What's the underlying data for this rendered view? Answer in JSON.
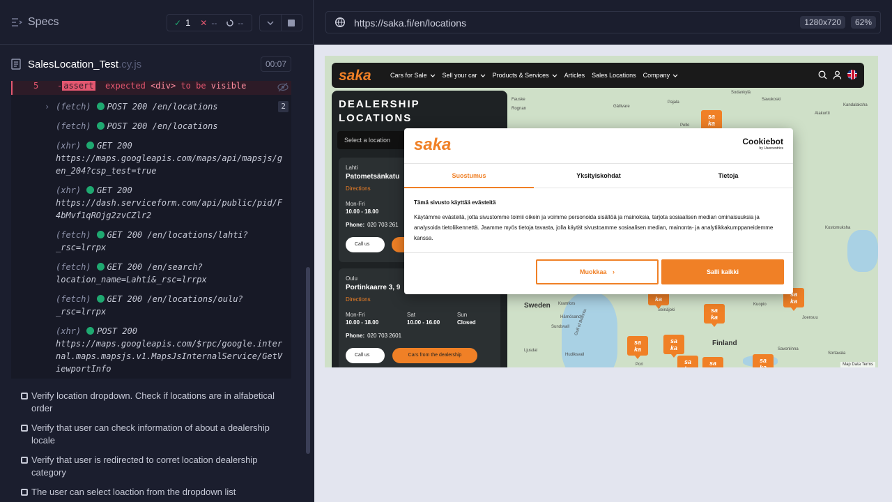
{
  "runner": {
    "specs_label": "Specs",
    "stats": {
      "passed": "1",
      "failed": "--",
      "pending": "--"
    },
    "file": {
      "name": "SalesLocation_Test",
      "ext": ".cy.js",
      "timer": "00:07"
    },
    "failed_command": {
      "number": "5",
      "prefix": "-",
      "assert": "assert",
      "text1": "expected",
      "tag": "<div>",
      "text2": "to be",
      "text3": "visible"
    },
    "commands": [
      {
        "kind": "(fetch)",
        "msg": "POST 200 /en/locations",
        "count": "2",
        "expandable": true
      },
      {
        "kind": "(fetch)",
        "msg": "POST 200 /en/locations"
      },
      {
        "kind": "(xhr)",
        "msg": "GET 200",
        "url": "https://maps.googleapis.com/maps/api/mapsjs/gen_204?csp_test=true"
      },
      {
        "kind": "(xhr)",
        "msg": "GET 200",
        "url": "https://dash.serviceform.com/api/public/pid/F4bMvf1qROjg2zvCZlr2"
      },
      {
        "kind": "(fetch)",
        "msg": "GET 200 /en/locations/lahti?",
        "url": "_rsc=lrrpx"
      },
      {
        "kind": "(fetch)",
        "msg": "GET 200 /en/search?",
        "url": "location_name=Lahti&_rsc=lrrpx"
      },
      {
        "kind": "(fetch)",
        "msg": "GET 200 /en/locations/oulu?",
        "url": "_rsc=lrrpx"
      },
      {
        "kind": "(xhr)",
        "msg": "POST 200",
        "url": "https://maps.googleapis.com/$rpc/google.internal.maps.mapsjs.v1.MapsJsInternalService/GetViewportInfo"
      }
    ],
    "tests": [
      "Verify location dropdown. Check if locations are in alfabetical order",
      "Verify that user can check information of about a dealership locale",
      "Verify that user is redirected to corret location dealership category",
      "The user can select loaction from the dropdown list"
    ]
  },
  "browser": {
    "url": "https://saka.fi/en/locations",
    "viewport": "1280x720",
    "zoom": "62%"
  },
  "site": {
    "brand": "saka",
    "nav": [
      "Cars for Sale",
      "Sell your car",
      "Products & Services",
      "Articles",
      "Sales Locations",
      "Company"
    ],
    "nav_dropdowns": [
      true,
      true,
      true,
      false,
      false,
      true
    ],
    "panel_title": "DEALERSHIP LOCATIONS",
    "select_placeholder": "Select a location",
    "cards": [
      {
        "city": "Lahti",
        "address": "Patometsänkatu",
        "directions": "Directions",
        "hours_label": "Mon-Fri",
        "hours_value": "10.00 - 18.00",
        "phone_label": "Phone:",
        "phone": "020 703 261",
        "call": "Call us"
      },
      {
        "city": "Oulu",
        "address": "Portinkaarre 3, 9",
        "directions": "Directions",
        "hours_label": "Mon-Fri",
        "hours_value": "10.00 - 18.00",
        "sat_label": "Sat",
        "sat_value": "10.00 - 16.00",
        "sun_label": "Sun",
        "sun_value": "Closed",
        "phone_label": "Phone:",
        "phone": "020 703 2601",
        "call": "Call us",
        "cars": "Cars from the dealership"
      }
    ],
    "map": {
      "countries": [
        "Sweden",
        "Finland"
      ],
      "cities": [
        "Fauske",
        "Rognan",
        "Pajala",
        "Gällivare",
        "Sodankylä",
        "Savukoski",
        "Pello",
        "Kandalaksha",
        "Alakurtti",
        "Kramfors",
        "Seinäjoki",
        "Härnösand",
        "Kuopio",
        "Joensuu",
        "Sundsvall",
        "Ljusdal",
        "Hudiksvall",
        "Savonlinna",
        "Pori",
        "Kostomuksha",
        "Gulf of Bothnia",
        "Sortavala"
      ],
      "attribution": [
        "Map Data",
        "Terms"
      ]
    },
    "cookie": {
      "brand": "saka",
      "provider": "Cookiebot",
      "provider_sub": "by Usercentrics",
      "tabs": [
        "Suostumus",
        "Yksityiskohdat",
        "Tietoja"
      ],
      "active_tab": 0,
      "heading": "Tämä sivusto käyttää evästeitä",
      "body": "Käytämme evästeitä, jotta sivustomme toimii oikein ja voimme personoida sisältöä ja mainoksia, tarjota sosiaalisen median ominaisuuksia ja analysoida tietoliikennettä. Jaamme myös tietoja tavasta, jolla käytät sivustoamme sosiaalisen median, mainonta- ja analytiikkakumppaneidemme kanssa.",
      "customize": "Muokkaa",
      "allow_all": "Salli kaikki"
    }
  },
  "colors": {
    "runner_bg": "#1b1e2e",
    "pass": "#1fa971",
    "fail": "#e45770",
    "brand_orange": "#f08026"
  }
}
